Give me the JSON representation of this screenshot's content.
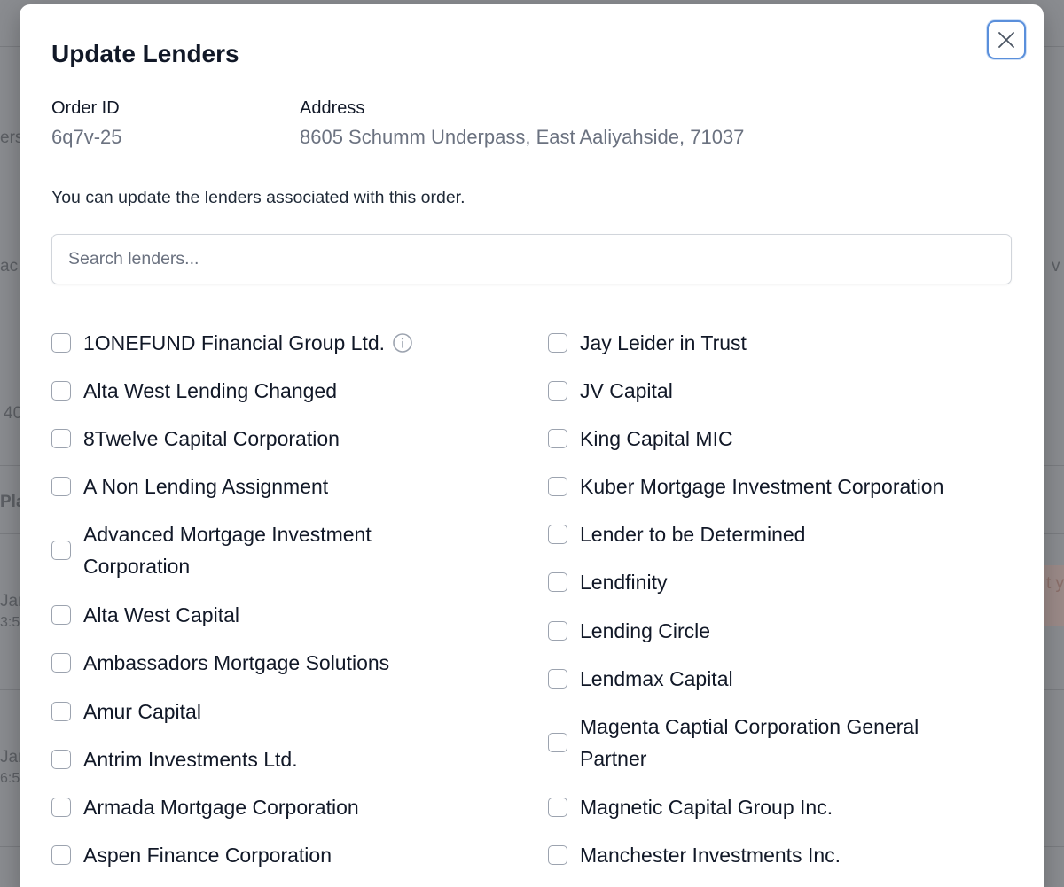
{
  "modal": {
    "title": "Update Lenders",
    "close_icon": "close-icon",
    "order_id_label": "Order ID",
    "order_id_value": "6q7v-25",
    "address_label": "Address",
    "address_value": "8605 Schumm Underpass, East Aaliyahside, 71037",
    "helper_text": "You can update the lenders associated with this order.",
    "search": {
      "placeholder": "Search lenders..."
    }
  },
  "lenders": {
    "left": [
      {
        "label": "1ONEFUND Financial Group Ltd.",
        "checked": false,
        "has_info_icon": true
      },
      {
        "label": "Alta West Lending Changed",
        "checked": false
      },
      {
        "label": "8Twelve Capital Corporation",
        "checked": false
      },
      {
        "label": "A Non Lending Assignment",
        "checked": false
      },
      {
        "label": "Advanced Mortgage Investment Corporation",
        "checked": false
      },
      {
        "label": "Alta West Capital",
        "checked": false
      },
      {
        "label": "Ambassadors Mortgage Solutions",
        "checked": false
      },
      {
        "label": "Amur Capital",
        "checked": false
      },
      {
        "label": "Antrim Investments Ltd.",
        "checked": false
      },
      {
        "label": "Armada Mortgage Corporation",
        "checked": false
      },
      {
        "label": "Aspen Finance Corporation",
        "checked": false
      }
    ],
    "right": [
      {
        "label": "Jay Leider in Trust",
        "checked": false
      },
      {
        "label": "JV Capital",
        "checked": false
      },
      {
        "label": "King Capital MIC",
        "checked": false
      },
      {
        "label": "Kuber Mortgage Investment Corporation",
        "checked": false
      },
      {
        "label": "Lender to be Determined",
        "checked": false
      },
      {
        "label": "Lendfinity",
        "checked": false
      },
      {
        "label": "Lending Circle",
        "checked": false
      },
      {
        "label": "Lendmax Capital",
        "checked": false
      },
      {
        "label": "Magenta Captial Corporation General Partner",
        "checked": false
      },
      {
        "label": "Magnetic Capital Group Inc.",
        "checked": false
      },
      {
        "label": "Manchester Investments Inc.",
        "checked": false
      }
    ]
  },
  "background": {
    "fragments": [
      "ers",
      "ac",
      "40",
      "Pla",
      "Jar",
      "3:5",
      "Jar",
      "6:5",
      "v",
      "t y"
    ]
  },
  "colors": {
    "close_button_border": "#5a8fdb",
    "text_primary": "#111827",
    "text_muted": "#6b7280",
    "checkbox_border": "#9ca3af"
  }
}
